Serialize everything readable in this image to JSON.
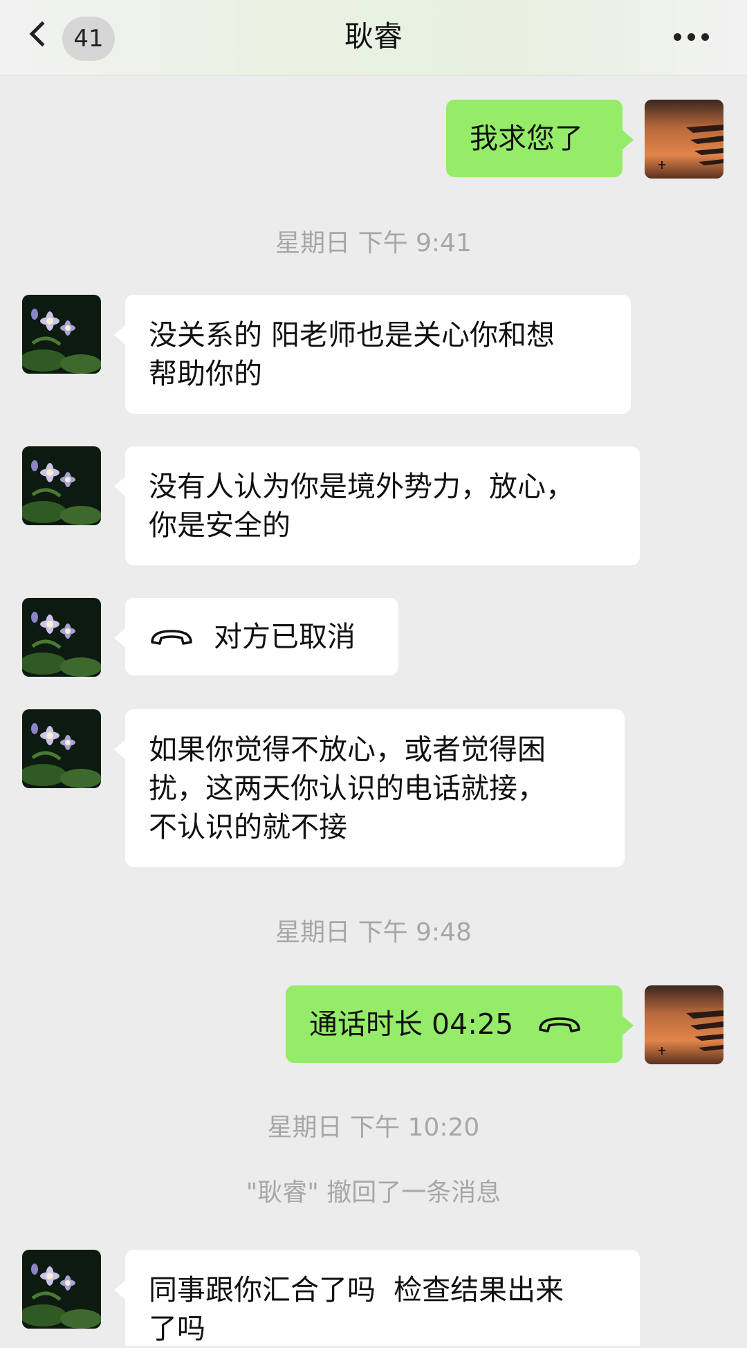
{
  "header": {
    "back_label": "<",
    "unread_count": "41",
    "title": "耿睿",
    "more_icon": "ellipsis-icon"
  },
  "colors": {
    "chat_background": "#ececec",
    "outgoing_bubble": "#95ec69",
    "incoming_bubble": "#ffffff",
    "system_text": "#a7a7a7"
  },
  "messages": [
    {
      "type": "text",
      "direction": "out",
      "text": "我求您了"
    },
    {
      "type": "time",
      "text": "星期日 下午 9:41"
    },
    {
      "type": "text",
      "direction": "in",
      "lines": [
        "没关系的 阳老师也是关心你和想",
        "帮助你的"
      ]
    },
    {
      "type": "text",
      "direction": "in",
      "lines": [
        "没有人认为你是境外势力，放心，",
        "你是安全的"
      ]
    },
    {
      "type": "call",
      "direction": "in",
      "text": "对方已取消",
      "icon": "phone-hangup-icon"
    },
    {
      "type": "text",
      "direction": "in",
      "lines": [
        "如果你觉得不放心，或者觉得困",
        "扰，这两天你认识的电话就接，",
        "不认识的就不接"
      ]
    },
    {
      "type": "time",
      "text": "星期日 下午 9:48"
    },
    {
      "type": "call",
      "direction": "out",
      "text": "通话时长 04:25",
      "icon": "phone-hangup-icon"
    },
    {
      "type": "time",
      "text": "星期日 下午 10:20"
    },
    {
      "type": "system",
      "text": "\"耿睿\" 撤回了一条消息"
    },
    {
      "type": "text",
      "direction": "in",
      "lines": [
        "同事跟你汇合了吗  检查结果出来",
        "了吗"
      ]
    }
  ]
}
